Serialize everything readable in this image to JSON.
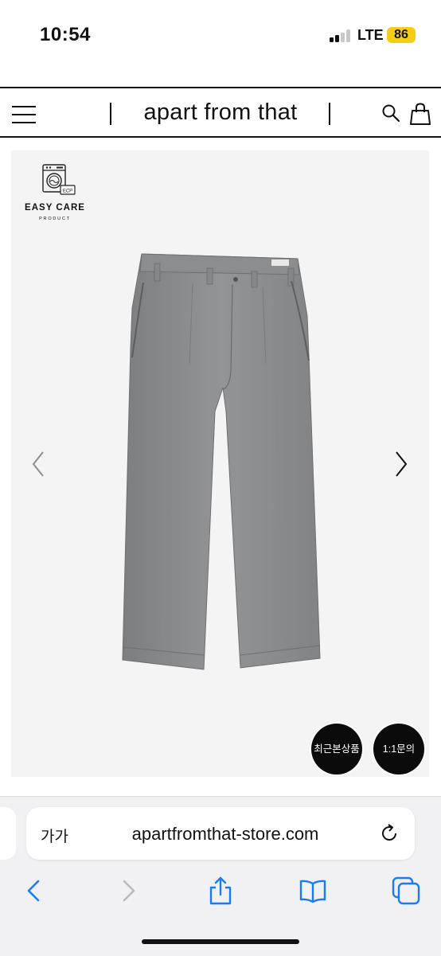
{
  "status_bar": {
    "time": "10:54",
    "network": "LTE",
    "battery": "86",
    "battery_color": "#f5cc16"
  },
  "header": {
    "brand": "apart from that",
    "icons": [
      "menu-icon",
      "search-icon",
      "shopping-bag-icon"
    ]
  },
  "product": {
    "badge_title": "EASY CARE",
    "badge_subtitle": "PRODUCT",
    "badge_icon_text": "ECP",
    "garment_color": "#8a8b8d",
    "background_color": "#f4f4f4"
  },
  "floating_buttons": {
    "recent": "최근본상품",
    "inquiry": "1:1문의"
  },
  "browser": {
    "text_size_label": "가가",
    "url": "apartfromthat-store.com",
    "accent_color": "#1a7cf5",
    "toolbar_icons": [
      "back-icon",
      "forward-icon",
      "share-icon",
      "bookmarks-icon",
      "tabs-icon"
    ]
  }
}
